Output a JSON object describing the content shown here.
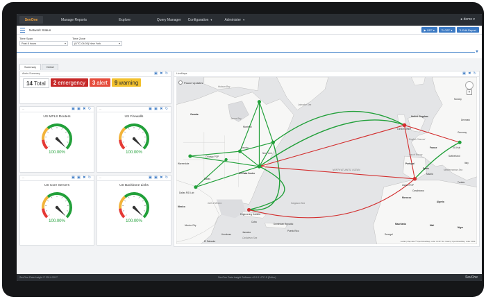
{
  "topnav": {
    "logo": "SevOne",
    "items": [
      "Manage Reports",
      "Explore",
      "Query Manager",
      "Configuration",
      "Administer"
    ],
    "user": "demo"
  },
  "toolbar": {
    "title": "Network Status",
    "buttons": [
      "OFF",
      "OFF",
      "Edit Report"
    ]
  },
  "filters": {
    "timespan_label": "Time Span",
    "timespan_value": "Past 8 hours",
    "timezone_label": "Time Zone",
    "timezone_value": "(UTC-04:00) New York"
  },
  "tabs": [
    {
      "label": "Summary",
      "active": true
    },
    {
      "label": "Detail",
      "active": false
    }
  ],
  "alert_summary": {
    "title": "Alerts Summary",
    "total_count": "14",
    "total_label": "Total",
    "emergency_count": "2",
    "emergency_label": "emergency",
    "alert_count": "3",
    "alert_label": "alert",
    "warning_count": "9",
    "warning_label": "warning"
  },
  "gauges": [
    {
      "title": "US MPLS Routers",
      "value": "100.00%",
      "level": 1.0
    },
    {
      "title": "US Firewalls",
      "value": "100.00%",
      "level": 1.0
    },
    {
      "title": "US Core Servers",
      "value": "100.00%",
      "level": 1.0
    },
    {
      "title": "US Backbone Links",
      "value": "100.00%",
      "level": 1.0
    }
  ],
  "map": {
    "title": "LiveMaps",
    "pause_label": "Pause Updates",
    "labels": {
      "hudson": "Hudson Bay",
      "labrador": "Labrador Sea",
      "canada": "Canada",
      "james": "James Bay",
      "montreal": "Montreal",
      "toronto": "Toronto",
      "chicago": "Chicago POP",
      "usdc": "US Data Center",
      "dallas": "Dallas",
      "sfo": "Dallas R/D Lab",
      "warrendale": "Warrendale",
      "nyc": "New York",
      "gulf": "Gulf of Mexico",
      "mexico": "Mexico",
      "mexcity": "Mexico City",
      "cuba": "Cuba",
      "engineering": "Engineering Havana",
      "sargasso": "Sargasso Sea",
      "north_atlantic": "NORTH ATLANTIC OCEAN",
      "uk": "United Kingdom",
      "london": "London",
      "lisbon": "Lisbon POP",
      "portugal": "Portugal",
      "spain": "Spain",
      "madrid": "Madrid",
      "france": "France",
      "morocco": "Morocco",
      "algeria": "Algeria",
      "mauritania": "Mauritania",
      "mali": "Mali",
      "niger": "Niger",
      "senegal": "Senegal",
      "euhub": "EU Hub",
      "euro_office": "London Office",
      "dominican": "Dominican Republic",
      "puerto": "Puerto Rico",
      "jamaica": "Jamaica",
      "haiti": "Haiti",
      "honduras": "Honduras",
      "salvador": "El Salvador",
      "caribbean": "Caribbean Sea",
      "bay_biscay": "Bay of Biscay",
      "english_channel": "English Channel",
      "mediterranean": "Mediterranean Sea",
      "tunisia": "Tunisia",
      "casablanca": "Casablanca",
      "norway": "Norway",
      "denmark": "Denmark",
      "germany": "Germany",
      "switzerland": "Switzerland",
      "italy": "Italy",
      "gibraltar": "Gibraltar"
    },
    "attribution": "Leaflet | Map data © OpenStreetMap, under CC BY SA. Data by OpenStreetMap, under ODbL"
  },
  "footer": {
    "left": "SevOne Data Insight © 2014-2017",
    "center": "SevOne Data Insight Software v2.0.0 UTC-5 (Editor)",
    "brand": "SevOne"
  },
  "colors": {
    "green": "#22a03a",
    "red": "#d32f2f",
    "accent": "#3b79c3"
  }
}
